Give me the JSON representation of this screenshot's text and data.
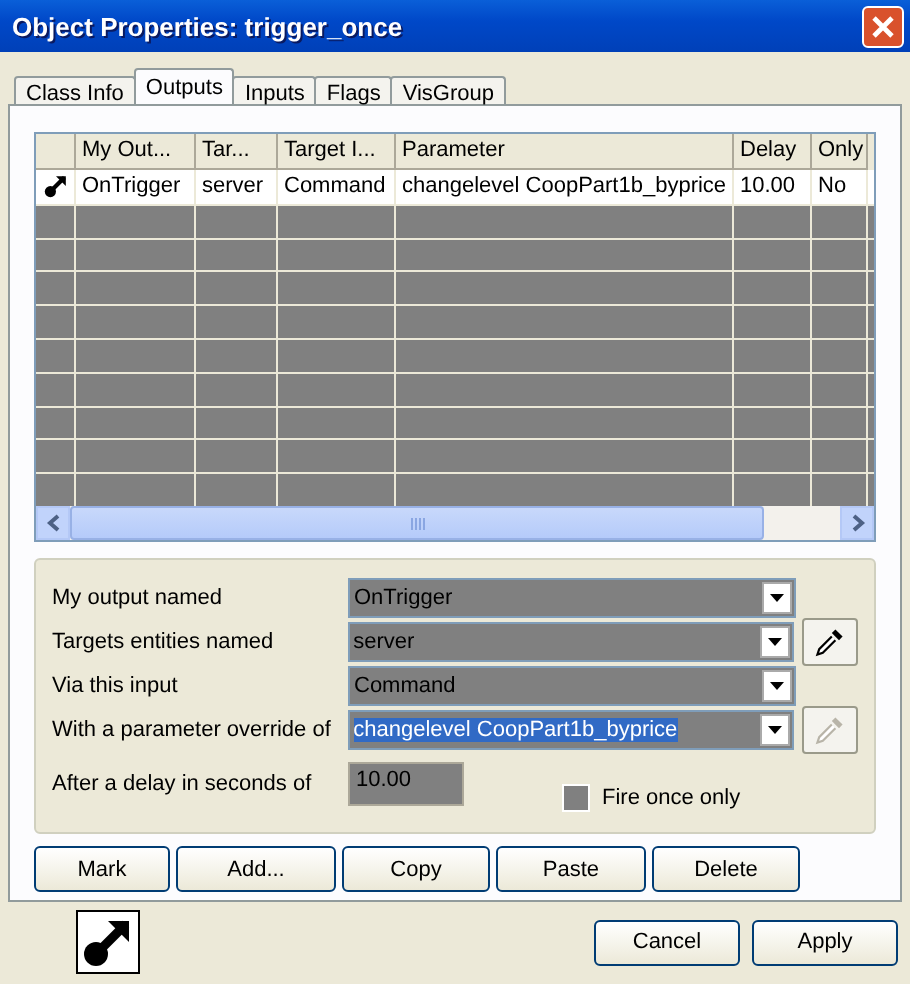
{
  "window": {
    "title": "Object Properties: trigger_once"
  },
  "tabs": [
    {
      "label": "Class Info",
      "selected": false
    },
    {
      "label": "Outputs",
      "selected": true
    },
    {
      "label": "Inputs",
      "selected": false
    },
    {
      "label": "Flags",
      "selected": false
    },
    {
      "label": "VisGroup",
      "selected": false
    }
  ],
  "table": {
    "columns": [
      "My Out...",
      "Tar...",
      "Target I...",
      "Parameter",
      "Delay",
      "Only"
    ],
    "rows": [
      {
        "selected": false,
        "cells": [
          "OnTrigger",
          "server",
          "Command",
          "changelevel CoopPart1b_byprice",
          "10.00",
          "No"
        ]
      }
    ]
  },
  "form": {
    "fields": [
      {
        "label": "My output named",
        "kind": "combo",
        "value": "OnTrigger",
        "highlighted": false
      },
      {
        "label": "Targets entities named",
        "kind": "combo",
        "value": "server",
        "highlighted": false,
        "picker": {
          "disabled": false
        }
      },
      {
        "label": "Via this input",
        "kind": "combo",
        "value": "Command",
        "highlighted": false
      },
      {
        "label": "With a parameter override of",
        "kind": "combo",
        "value": "changelevel CoopPart1b_byprice",
        "highlighted": true,
        "picker": {
          "disabled": true
        }
      },
      {
        "label": "After a delay in seconds of",
        "kind": "text",
        "value": "10.00"
      }
    ],
    "fire_once": {
      "label": "Fire once only",
      "checked": false
    }
  },
  "actions": [
    "Mark",
    "Add...",
    "Copy",
    "Paste",
    "Delete"
  ],
  "footer_buttons": [
    "Cancel",
    "Apply"
  ]
}
